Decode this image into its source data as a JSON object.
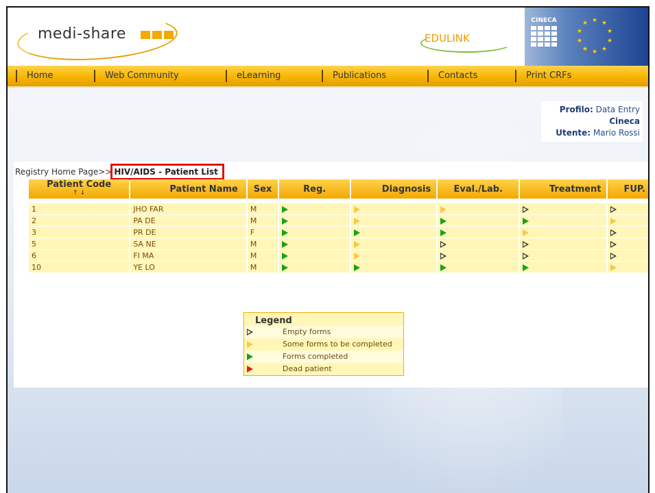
{
  "header": {
    "logo_text": "medi-share",
    "edulink_text": "EDULINK",
    "cineca_text": "CINECA"
  },
  "nav": {
    "items": [
      "Home",
      "Web Community",
      "eLearning",
      "Publications",
      "Contacts",
      "Print CRFs"
    ]
  },
  "profile": {
    "profile_label": "Profilo:",
    "profile_value": "Data Entry",
    "organization": "Cineca",
    "user_label": "Utente:",
    "user_value": "Mario Rossi"
  },
  "breadcrumb": {
    "home": "Registry Home Page>>",
    "current": "HIV/AIDS - Patient List"
  },
  "table": {
    "headers": [
      "Patient Code",
      "Patient Name",
      "Sex",
      "Reg.",
      "Diagnosis",
      "Eval./Lab.",
      "Treatment",
      "FUP."
    ],
    "sort_arrows": "↑ ↓",
    "rows": [
      {
        "code": "1",
        "name": "JHO FAR",
        "sex": "M",
        "status": [
          "green",
          "yellow",
          "yellow",
          "empty",
          "empty"
        ]
      },
      {
        "code": "2",
        "name": "PA DE",
        "sex": "M",
        "status": [
          "green",
          "yellow",
          "green",
          "green",
          "yellow"
        ]
      },
      {
        "code": "3",
        "name": "PR DE",
        "sex": "F",
        "status": [
          "green",
          "green",
          "green",
          "yellow",
          "empty"
        ]
      },
      {
        "code": "5",
        "name": "SA NE",
        "sex": "M",
        "status": [
          "green",
          "yellow",
          "empty",
          "empty",
          "empty"
        ]
      },
      {
        "code": "6",
        "name": "FI MA",
        "sex": "M",
        "status": [
          "green",
          "yellow",
          "empty",
          "empty",
          "empty"
        ]
      },
      {
        "code": "10",
        "name": "YE LO",
        "sex": "M",
        "status": [
          "green",
          "green",
          "green",
          "green",
          "yellow"
        ]
      }
    ]
  },
  "legend": {
    "title": "Legend",
    "items": [
      {
        "icon": "empty",
        "label": "Empty forms"
      },
      {
        "icon": "yellow",
        "label": "Some forms to be completed"
      },
      {
        "icon": "green",
        "label": "Forms completed"
      },
      {
        "icon": "red",
        "label": "Dead patient"
      }
    ]
  },
  "colors": {
    "nav_orange": "#f7b500",
    "completed_green": "#16a316",
    "partial_yellow": "#f7c84a",
    "dead_red": "#e02020",
    "row_bg": "#fff6b8",
    "highlight_red": "#e01010"
  }
}
